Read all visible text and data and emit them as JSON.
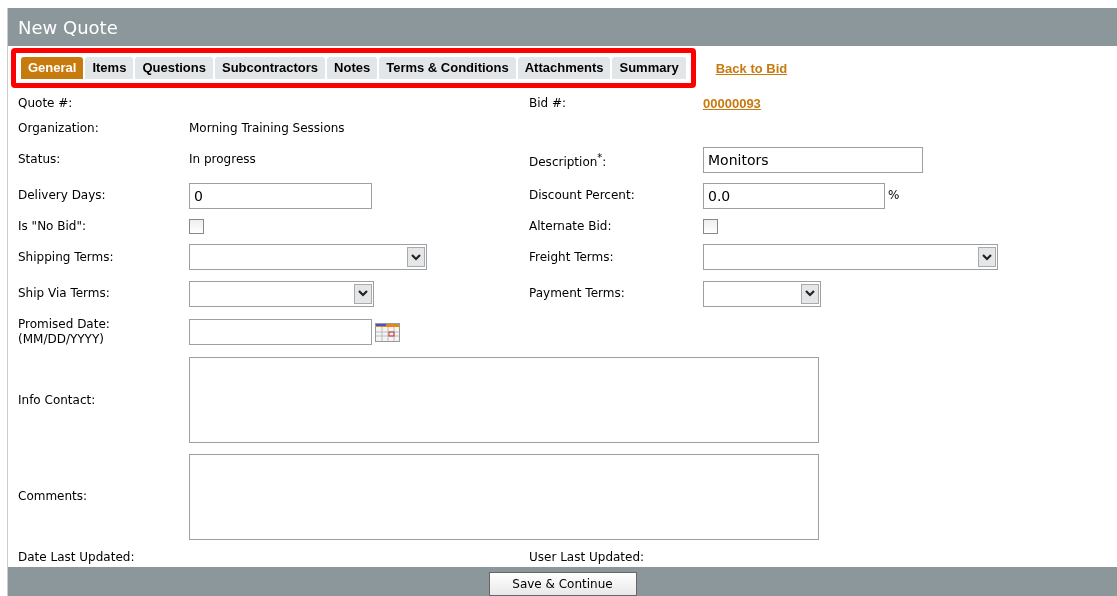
{
  "window": {
    "title": "New Quote"
  },
  "tabs": [
    {
      "label": "General",
      "selected": true
    },
    {
      "label": "Items",
      "selected": false
    },
    {
      "label": "Questions",
      "selected": false
    },
    {
      "label": "Subcontractors",
      "selected": false
    },
    {
      "label": "Notes",
      "selected": false
    },
    {
      "label": "Terms & Conditions",
      "selected": false
    },
    {
      "label": "Attachments",
      "selected": false
    },
    {
      "label": "Summary",
      "selected": false
    }
  ],
  "back_link": "Back to Bid",
  "rows": [
    {
      "left": {
        "label": "Quote #:",
        "kind": "text"
      },
      "right": {
        "label": "Bid #:",
        "kind": "link",
        "value": "00000093"
      }
    },
    {
      "left": {
        "label": "Organization:",
        "kind": "text",
        "value": "Morning Training Sessions"
      }
    },
    {
      "left": {
        "label": "Status:",
        "kind": "text",
        "value": "In progress"
      },
      "right": {
        "label": "Description$^{*}$:",
        "kind": "input",
        "value": "Monitors"
      }
    },
    {
      "left": {
        "label": "Delivery Days:",
        "kind": "input",
        "value": "0"
      },
      "right": {
        "label": "Discount Percent:",
        "kind": "input",
        "value": "0.0",
        "unit": "%"
      }
    },
    {
      "left": {
        "label": "Is \"No Bid\":",
        "kind": "checkbox",
        "checked": false
      },
      "right": {
        "label": "Alternate Bid:",
        "kind": "checkbox",
        "checked": false
      }
    },
    {
      "left": {
        "label": "Shipping Terms:",
        "kind": "select"
      },
      "right": {
        "label": "Freight Terms:",
        "kind": "select"
      }
    },
    {
      "left": {
        "label": "Ship Via Terms:",
        "kind": "select"
      },
      "right": {
        "label": "Payment Terms:",
        "kind": "select"
      }
    },
    {
      "left": {
        "label": "Promised Date:",
        "hint": "(MM/DD/YYYY)",
        "kind": "date"
      }
    },
    {
      "left": {
        "label": "Info Contact:",
        "kind": "textarea"
      }
    },
    {
      "left": {
        "label": "Comments:",
        "kind": "textarea"
      }
    },
    {
      "left": {
        "label": "Date Last Updated:",
        "kind": "text"
      },
      "right": {
        "label": "User Last Updated:",
        "kind": "text"
      }
    }
  ],
  "save_button": "Save & Continue"
}
